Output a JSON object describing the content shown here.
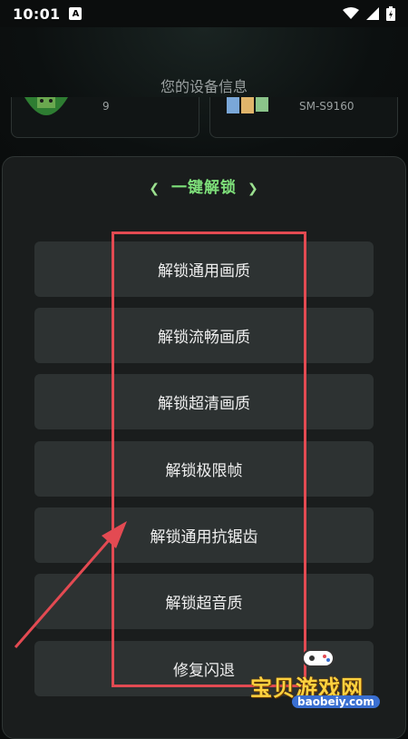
{
  "status": {
    "time": "10:01",
    "notif": "A"
  },
  "device_info": {
    "title": "您的设备信息",
    "left_value": "9",
    "right_value": "SM-S9160"
  },
  "panel": {
    "heading": "一键解锁",
    "left_chevron": "❮",
    "right_chevron": "❯"
  },
  "buttons": [
    "解锁通用画质",
    "解锁流畅画质",
    "解锁超清画质",
    "解锁极限帧",
    "解锁通用抗锯齿",
    "解锁超音质",
    "修复闪退"
  ],
  "watermark": {
    "text": "宝贝游戏网",
    "url": "baobeiy.com"
  },
  "colors": {
    "highlight": "#e34a52",
    "accent": "#7ee07a",
    "button_bg": "#2d3232"
  }
}
